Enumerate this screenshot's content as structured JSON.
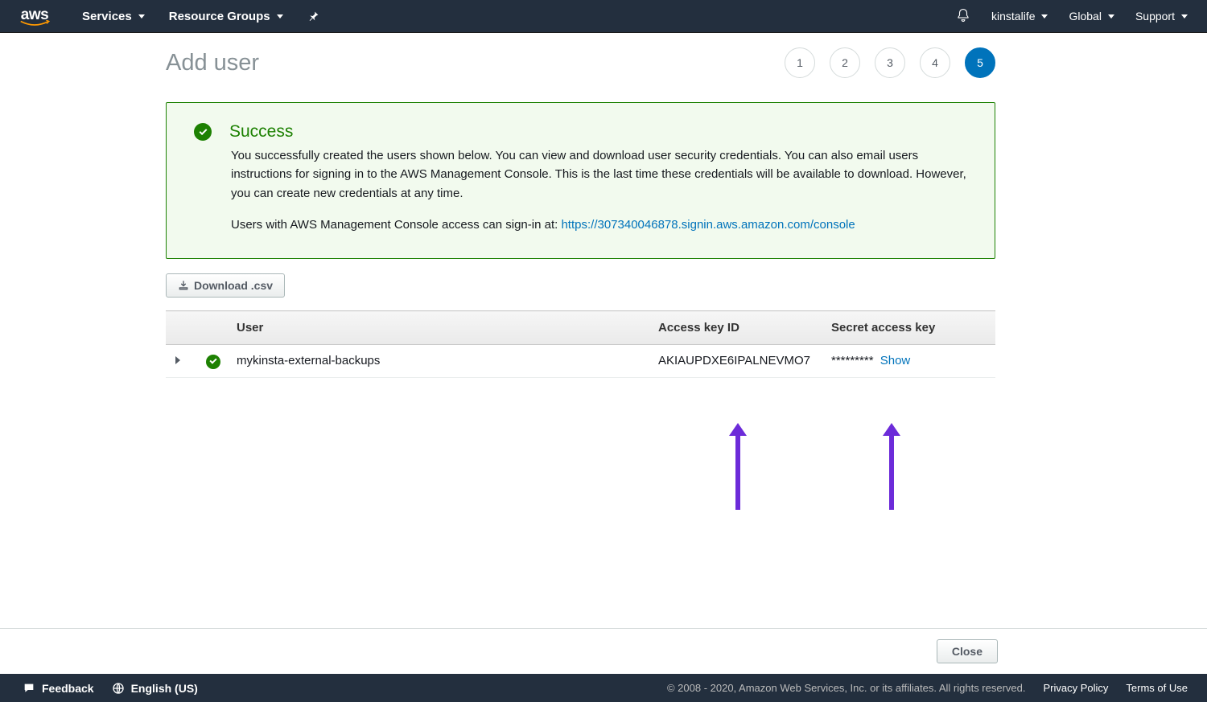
{
  "nav": {
    "logo_text": "aws",
    "services": "Services",
    "resource_groups": "Resource Groups",
    "account": "kinstalife",
    "region": "Global",
    "support": "Support"
  },
  "page": {
    "title": "Add user",
    "steps": [
      "1",
      "2",
      "3",
      "4",
      "5"
    ],
    "active_step_index": 4
  },
  "success": {
    "title": "Success",
    "para1": "You successfully created the users shown below. You can view and download user security credentials. You can also email users instructions for signing in to the AWS Management Console. This is the last time these credentials will be available to download. However, you can create new credentials at any time.",
    "para2_prefix": "Users with AWS Management Console access can sign-in at: ",
    "signin_url": "https://307340046878.signin.aws.amazon.com/console"
  },
  "download_btn": "Download .csv",
  "table": {
    "headers": {
      "user": "User",
      "access_key": "Access key ID",
      "secret": "Secret access key"
    },
    "rows": [
      {
        "user": "mykinsta-external-backups",
        "access_key_id": "AKIAUPDXE6IPALNEVMO7",
        "secret_masked": "*********",
        "show_label": "Show"
      }
    ]
  },
  "close_btn": "Close",
  "footer": {
    "feedback": "Feedback",
    "language": "English (US)",
    "copyright": "© 2008 - 2020, Amazon Web Services, Inc. or its affiliates. All rights reserved.",
    "privacy": "Privacy Policy",
    "terms": "Terms of Use"
  }
}
